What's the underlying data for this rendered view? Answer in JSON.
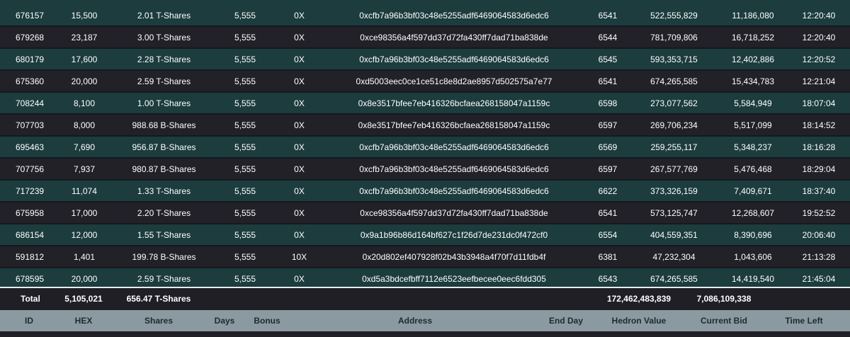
{
  "columns": [
    "ID",
    "HEX",
    "Shares",
    "Days",
    "Bonus",
    "Address",
    "End Day",
    "Hedron Value",
    "Current Bid",
    "Time Left"
  ],
  "rows": [
    {
      "id": "676157",
      "hex": "15,500",
      "shares": "2.01 T-Shares",
      "days": "5,555",
      "bonus": "0X",
      "address": "0xcfb7a96b3bf03c48e5255adf6469064583d6edc6",
      "end_day": "6541",
      "hedron_value": "522,555,829",
      "current_bid": "11,186,080",
      "time_left": "12:20:40"
    },
    {
      "id": "679268",
      "hex": "23,187",
      "shares": "3.00 T-Shares",
      "days": "5,555",
      "bonus": "0X",
      "address": "0xce98356a4f597dd37d72fa430ff7dad71ba838de",
      "end_day": "6544",
      "hedron_value": "781,709,806",
      "current_bid": "16,718,252",
      "time_left": "12:20:40"
    },
    {
      "id": "680179",
      "hex": "17,600",
      "shares": "2.28 T-Shares",
      "days": "5,555",
      "bonus": "0X",
      "address": "0xcfb7a96b3bf03c48e5255adf6469064583d6edc6",
      "end_day": "6545",
      "hedron_value": "593,353,715",
      "current_bid": "12,402,886",
      "time_left": "12:20:52"
    },
    {
      "id": "675360",
      "hex": "20,000",
      "shares": "2.59 T-Shares",
      "days": "5,555",
      "bonus": "0X",
      "address": "0xd5003eec0ce1ce51c8e8d2ae8957d502575a7e77",
      "end_day": "6541",
      "hedron_value": "674,265,585",
      "current_bid": "15,434,783",
      "time_left": "12:21:04"
    },
    {
      "id": "708244",
      "hex": "8,100",
      "shares": "1.00 T-Shares",
      "days": "5,555",
      "bonus": "0X",
      "address": "0x8e3517bfee7eb416326bcfaea268158047a1159c",
      "end_day": "6598",
      "hedron_value": "273,077,562",
      "current_bid": "5,584,949",
      "time_left": "18:07:04"
    },
    {
      "id": "707703",
      "hex": "8,000",
      "shares": "988.68 B-Shares",
      "days": "5,555",
      "bonus": "0X",
      "address": "0x8e3517bfee7eb416326bcfaea268158047a1159c",
      "end_day": "6597",
      "hedron_value": "269,706,234",
      "current_bid": "5,517,099",
      "time_left": "18:14:52"
    },
    {
      "id": "695463",
      "hex": "7,690",
      "shares": "956.87 B-Shares",
      "days": "5,555",
      "bonus": "0X",
      "address": "0xcfb7a96b3bf03c48e5255adf6469064583d6edc6",
      "end_day": "6569",
      "hedron_value": "259,255,117",
      "current_bid": "5,348,237",
      "time_left": "18:16:28"
    },
    {
      "id": "707756",
      "hex": "7,937",
      "shares": "980.87 B-Shares",
      "days": "5,555",
      "bonus": "0X",
      "address": "0xcfb7a96b3bf03c48e5255adf6469064583d6edc6",
      "end_day": "6597",
      "hedron_value": "267,577,769",
      "current_bid": "5,476,468",
      "time_left": "18:29:04"
    },
    {
      "id": "717239",
      "hex": "11,074",
      "shares": "1.33 T-Shares",
      "days": "5,555",
      "bonus": "0X",
      "address": "0xcfb7a96b3bf03c48e5255adf6469064583d6edc6",
      "end_day": "6622",
      "hedron_value": "373,326,159",
      "current_bid": "7,409,671",
      "time_left": "18:37:40"
    },
    {
      "id": "675958",
      "hex": "17,000",
      "shares": "2.20 T-Shares",
      "days": "5,555",
      "bonus": "0X",
      "address": "0xce98356a4f597dd37d72fa430ff7dad71ba838de",
      "end_day": "6541",
      "hedron_value": "573,125,747",
      "current_bid": "12,268,607",
      "time_left": "19:52:52"
    },
    {
      "id": "686154",
      "hex": "12,000",
      "shares": "1.55 T-Shares",
      "days": "5,555",
      "bonus": "0X",
      "address": "0x9a1b96b86d164bf627c1f26d7de231dc0f472cf0",
      "end_day": "6554",
      "hedron_value": "404,559,351",
      "current_bid": "8,390,696",
      "time_left": "20:06:40"
    },
    {
      "id": "591812",
      "hex": "1,401",
      "shares": "199.78 B-Shares",
      "days": "5,555",
      "bonus": "10X",
      "address": "0x20d802ef407928f02b43b3948a4f70f7d11fdb4f",
      "end_day": "6381",
      "hedron_value": "47,232,304",
      "current_bid": "1,043,606",
      "time_left": "21:13:28"
    },
    {
      "id": "678595",
      "hex": "20,000",
      "shares": "2.59 T-Shares",
      "days": "5,555",
      "bonus": "0X",
      "address": "0xd5a3bdcefbff7112e6523eefbecee0eec6fdd305",
      "end_day": "6543",
      "hedron_value": "674,265,585",
      "current_bid": "14,419,540",
      "time_left": "21:45:04"
    }
  ],
  "totals": {
    "label": "Total",
    "hex": "5,105,021",
    "shares": "656.47 T-Shares",
    "hedron_value": "172,462,483,839",
    "current_bid": "7,086,109,338"
  },
  "colors": {
    "row_teal": "#1c3c3e",
    "row_dark": "#222128",
    "header_bg": "#8a9aa0",
    "header_text": "#1e2a30"
  }
}
